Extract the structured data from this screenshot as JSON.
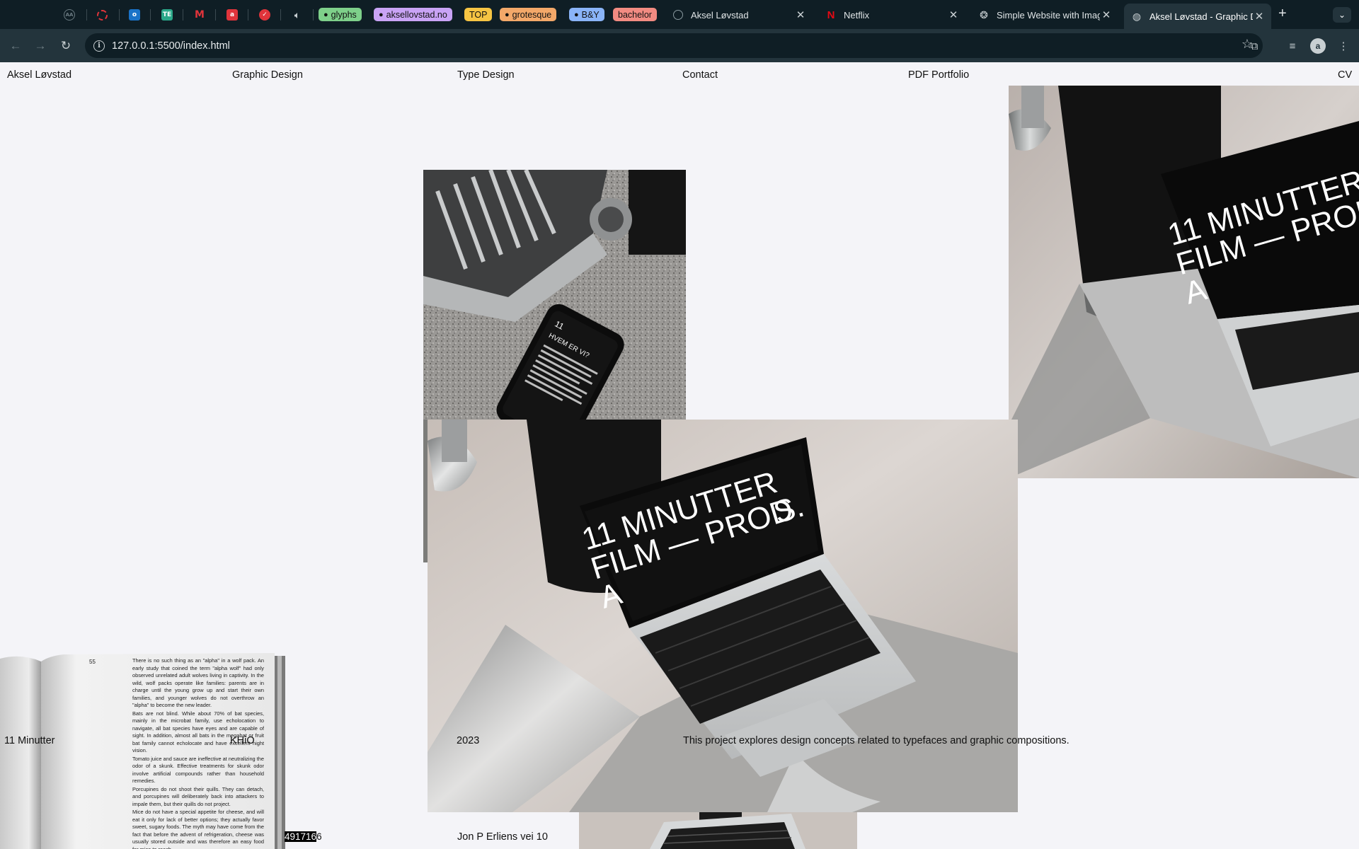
{
  "browser": {
    "pinned": [
      {
        "icon": "aa-icon",
        "color": "#3a4a52"
      },
      {
        "icon": "opera-icon",
        "color": "#e0343b"
      },
      {
        "icon": "outlook-icon",
        "color": "#1a73c8"
      },
      {
        "icon": "te-icon",
        "color": "#2aa889"
      },
      {
        "icon": "gmail-icon",
        "color": "#ffffff"
      },
      {
        "icon": "app-icon",
        "color": "#e0343b"
      },
      {
        "icon": "todoist-icon",
        "color": "#e0343b"
      }
    ],
    "groups": [
      {
        "label": "glyphs",
        "color": "#7ed08a"
      },
      {
        "label": "aksellovstad.no",
        "color": "#c9a3f5"
      },
      {
        "label": "TOP",
        "color": "#f6c443"
      },
      {
        "label": "grotesque",
        "color": "#f3a869"
      },
      {
        "label": "B&Y",
        "color": "#8ab4f8"
      },
      {
        "label": "bachelor",
        "color": "#f28b82"
      }
    ],
    "tabs": [
      {
        "title": "Aksel Løvstad",
        "icon": "aa-icon"
      },
      {
        "title": "Netflix",
        "icon": "netflix-icon"
      },
      {
        "title": "Simple Website with Imag",
        "icon": "openai-icon"
      },
      {
        "title": "Aksel Løvstad - Graphic D",
        "icon": "globe-icon"
      }
    ],
    "url": "127.0.0.1:5500/index.html"
  },
  "nav": {
    "name": "Aksel Løvstad",
    "graphic": "Graphic Design",
    "type": "Type Design",
    "contact": "Contact",
    "pdf": "PDF Portfolio",
    "cv": "CV"
  },
  "project": {
    "title": "11 Minutter",
    "client": "KHiO",
    "year": "2023",
    "description": "This project explores design concepts related to typefaces and graphic compositions."
  },
  "footer": {
    "phone_highlight": "491716",
    "phone_rest": "6",
    "address": "Jon P Erliens vei 10"
  },
  "images": {
    "laptop_screen": [
      "11 MINUTTER",
      "FILM — PROD",
      "A",
      "S."
    ],
    "phone_screen": [
      "11",
      "HVEM ER VI?"
    ],
    "book": {
      "page_number": "55",
      "paragraphs": [
        "There is no such thing as an \"alpha\" in a wolf pack. An early study that coined the term \"alpha wolf\" had only observed unrelated adult wolves living in captivity. In the wild, wolf packs operate like families: parents are in charge until the young grow up and start their own families, and younger wolves do not overthrow an \"alpha\" to become the new leader.",
        "Bats are not blind. While about 70% of bat species, mainly in the microbat family, use echolocation to navigate, all bat species have eyes and are capable of sight. In addition, almost all bats in the megabat or fruit bat family cannot echolocate and have excellent night vision.",
        "Tomato juice and sauce are ineffective at neutralizing the odor of a skunk. Effective treatments for skunk odor involve artificial compounds rather than household remedies.",
        "Porcupines do not shoot their quills. They can detach, and porcupines will deliberately back into attackers to impale them, but their quills do not project.",
        "Mice do not have a special appetite for cheese, and will eat it only for lack of better options; they actually favor sweet, sugary foods. The myth may have come from the fact that before the advent of refrigeration, cheese was usually stored outside and was therefore an easy food for mice to reach."
      ]
    }
  }
}
